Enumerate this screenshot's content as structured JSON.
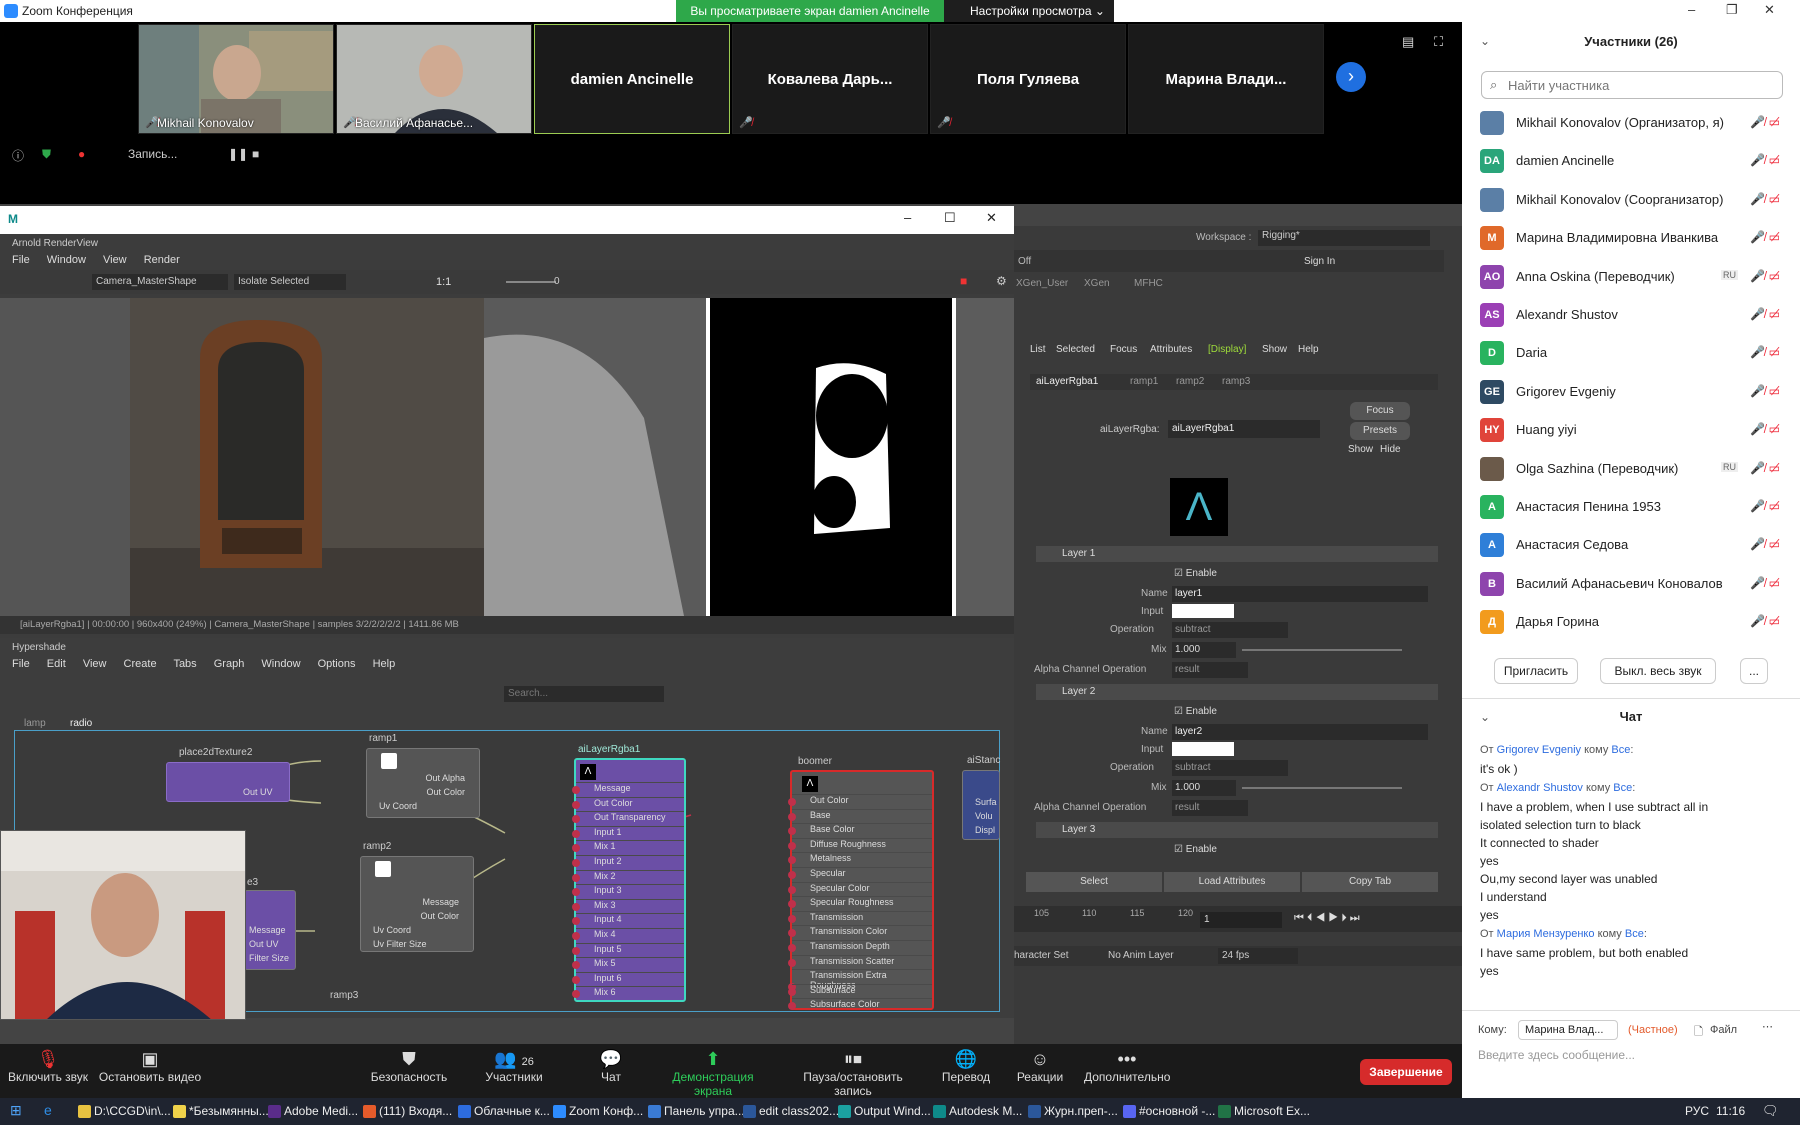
{
  "window": {
    "title": "Zoom Конференция"
  },
  "share": {
    "banner": "Вы просматриваете экран damien Ancinelle",
    "view_settings": "Настройки просмотра"
  },
  "strip": {
    "tiles": [
      {
        "name": "Mikhail Konovalov",
        "video": true
      },
      {
        "name": "Василий Афанасье...",
        "video": true
      },
      {
        "name": "damien Ancinelle",
        "video": false
      },
      {
        "name": "Ковалева Дарь...",
        "video": false
      },
      {
        "name": "Поля Гуляева",
        "video": false
      },
      {
        "name": "Марина Влади...",
        "video": false
      }
    ]
  },
  "recording": {
    "label": "Запись..."
  },
  "arnold": {
    "title": "Arnold RenderView",
    "menu": [
      "File",
      "Window",
      "View",
      "Render"
    ],
    "camera": "Camera_MasterShape",
    "isolate": "Isolate Selected",
    "ratio": "1:1",
    "exposure": "0",
    "status": "[aiLayerRgba1] | 00:00:00 | 960x400 (249%) | Camera_MasterShape | samples 3/2/2/2/2/2 | 1411.86 MB"
  },
  "hypershade": {
    "title": "Hypershade",
    "menu": [
      "File",
      "Edit",
      "View",
      "Create",
      "Tabs",
      "Graph",
      "Window",
      "Options",
      "Help"
    ],
    "search_placeholder": "Search...",
    "tabs": [
      "lamp",
      "radio"
    ],
    "nodes": {
      "place2d": {
        "title": "place2dTexture2",
        "rows": [
          "Out UV"
        ]
      },
      "ramp1": {
        "title": "ramp1",
        "rows": [
          "Out Alpha",
          "Out Color",
          "Uv Coord"
        ]
      },
      "ramp2": {
        "title": "ramp2",
        "rows": [
          "Message",
          "Out Color",
          "Uv Coord",
          "Uv Filter Size"
        ]
      },
      "ramp3": {
        "title": "ramp3"
      },
      "layer": {
        "title": "aiLayerRgba1",
        "rows": [
          "Message",
          "Out Color",
          "Out Transparency",
          "Input 1",
          "Mix 1",
          "Input 2",
          "Mix 2",
          "Input 3",
          "Mix 3",
          "Input 4",
          "Mix 4",
          "Input 5",
          "Mix 5",
          "Input 6",
          "Mix 6"
        ]
      },
      "boomer": {
        "title": "boomer",
        "rows": [
          "Out Color",
          "Base",
          "Base Color",
          "Diffuse Roughness",
          "Metalness",
          "Specular",
          "Specular Color",
          "Specular Roughness",
          "Transmission",
          "Transmission Color",
          "Transmission Depth",
          "Transmission Scatter",
          "Transmission Extra Roughness",
          "Subsurface",
          "Subsurface Color"
        ]
      },
      "standard": {
        "title": "aiStanc",
        "rows": [
          "Surfa",
          "Volu",
          "Displ"
        ]
      },
      "partial": {
        "title": "e3",
        "rows": [
          "Message",
          "Out UV",
          "Filter Size"
        ]
      }
    }
  },
  "maya": {
    "workspace_label": "Workspace :",
    "workspace": "Rigging*",
    "sign_in": "Sign In",
    "shelf_tabs": [
      "XGen_User",
      "XGen",
      "MFHC"
    ],
    "ae_menu": [
      "List",
      "Selected",
      "Focus",
      "Attributes",
      "[Display]",
      "Show",
      "Help"
    ],
    "ae_tabs": [
      "aiLayerRgba1",
      "ramp1",
      "ramp2",
      "ramp3"
    ],
    "node_label": "aiLayerRgba:",
    "node_value": "aiLayerRgba1",
    "side_buttons": [
      "Focus",
      "Presets",
      "Show",
      "Hide"
    ],
    "layers": [
      {
        "title": "Layer 1",
        "enable": "Enable",
        "name": "layer1",
        "operation": "subtract",
        "mix": "1.000",
        "alpha_op": "result"
      },
      {
        "title": "Layer 2",
        "enable": "Enable",
        "name": "layer2",
        "operation": "subtract",
        "mix": "1.000",
        "alpha_op": "result"
      },
      {
        "title": "Layer 3",
        "enable": "Enable"
      }
    ],
    "field_labels": {
      "name": "Name",
      "input": "Input",
      "operation": "Operation",
      "mix": "Mix",
      "alpha": "Alpha Channel Operation"
    },
    "bottom_buttons": [
      "Select",
      "Load Attributes",
      "Copy Tab"
    ],
    "timeline_ticks": [
      "105",
      "110",
      "115",
      "120"
    ],
    "frame": "1",
    "char_set": "haracter Set",
    "anim_layer": "No Anim Layer",
    "fps": "24 fps",
    "off_label": "Off"
  },
  "participants": {
    "header": "Участники (26)",
    "search_placeholder": "Найти участника",
    "list": [
      {
        "name": "Mikhail Konovalov (Организатор, я)",
        "initials": "",
        "color": "#5b7fa6"
      },
      {
        "name": "damien Ancinelle",
        "initials": "DA",
        "color": "#2aa57a"
      },
      {
        "name": "Mikhail Konovalov (Соорганизатор)",
        "initials": "",
        "color": "#5b7fa6"
      },
      {
        "name": "Марина Владимировна Иванкива",
        "initials": "М",
        "color": "#e0692a"
      },
      {
        "name": "Anna Oskina (Переводчик)",
        "initials": "AO",
        "color": "#8e44ad",
        "badge": "RU"
      },
      {
        "name": "Alexandr Shustov",
        "initials": "AS",
        "color": "#9b3fb5"
      },
      {
        "name": "Daria",
        "initials": "D",
        "color": "#29b35f"
      },
      {
        "name": "Grigorev Evgeniy",
        "initials": "GE",
        "color": "#2e4a63"
      },
      {
        "name": "Huang yiyi",
        "initials": "HY",
        "color": "#e0443a"
      },
      {
        "name": "Olga Sazhina (Переводчик)",
        "initials": "",
        "color": "#6b5a4a",
        "badge": "RU"
      },
      {
        "name": "Анастасия Пенина 1953",
        "initials": "A",
        "color": "#29b35f"
      },
      {
        "name": "Анастасия Седова",
        "initials": "A",
        "color": "#2f7fd8"
      },
      {
        "name": "Василий Афанасьевич Коновалов",
        "initials": "B",
        "color": "#8e44ad"
      },
      {
        "name": "Дарья Горина",
        "initials": "Д",
        "color": "#f29b1d"
      }
    ],
    "invite": "Пригласить",
    "mute_all": "Выкл. весь звук",
    "more": "..."
  },
  "chat": {
    "header": "Чат",
    "messages": [
      {
        "from": "Grigorev Evgeniy",
        "to": "Все",
        "lines": [
          "it's ok )"
        ]
      },
      {
        "from": "Alexandr Shustov",
        "to": "Все",
        "lines": [
          "I have a problem, when I use subtract all in",
          "isolated selection turn to black",
          "It connected to shader",
          "yes",
          "Ou,my second layer was unabled",
          "I understand",
          "yes"
        ]
      },
      {
        "from": "Мария Мензуренко",
        "to": "Все",
        "lines": [
          "I have same problem, but both enabled",
          "yes"
        ]
      }
    ],
    "from_word": "От",
    "to_word": "кому",
    "to_label": "Кому:",
    "recipient": "Марина Влад...",
    "private": "(Частное)",
    "file": "Файл",
    "input_placeholder": "Введите здесь сообщение..."
  },
  "toolbar": {
    "unmute": "Включить звук",
    "stop_video": "Остановить видео",
    "security": "Безопасность",
    "participants": "Участники",
    "participants_count": "26",
    "chat": "Чат",
    "share": "Демонстрация экрана",
    "pause_record": "Пауза/остановить запись",
    "translate": "Перевод",
    "reactions": "Реакции",
    "more": "Дополнительно",
    "end": "Завершение"
  },
  "taskbar": {
    "items": [
      {
        "label": "D:\\CCGD\\in\\...",
        "color": "#e8c341"
      },
      {
        "label": "*Безымянны...",
        "color": "#f0d24a"
      },
      {
        "label": "Adobe Medi...",
        "color": "#5a2c8a"
      },
      {
        "label": "(111) Входя...",
        "color": "#e55b2b"
      },
      {
        "label": "Облачные к...",
        "color": "#2d6cdf"
      },
      {
        "label": "Zoom Конф...",
        "color": "#2d8cff"
      },
      {
        "label": "Панель упра...",
        "color": "#3a7bd5"
      },
      {
        "label": "edit class202...",
        "color": "#2b579a"
      },
      {
        "label": "Output Wind...",
        "color": "#1ba1a1"
      },
      {
        "label": "Autodesk M...",
        "color": "#0e8a8a"
      },
      {
        "label": "Журн.преп-...",
        "color": "#2b579a"
      },
      {
        "label": "#основной -...",
        "color": "#5865f2"
      },
      {
        "label": "Microsoft Ex...",
        "color": "#217346"
      }
    ],
    "lang": "РУС",
    "time": "11:16"
  }
}
